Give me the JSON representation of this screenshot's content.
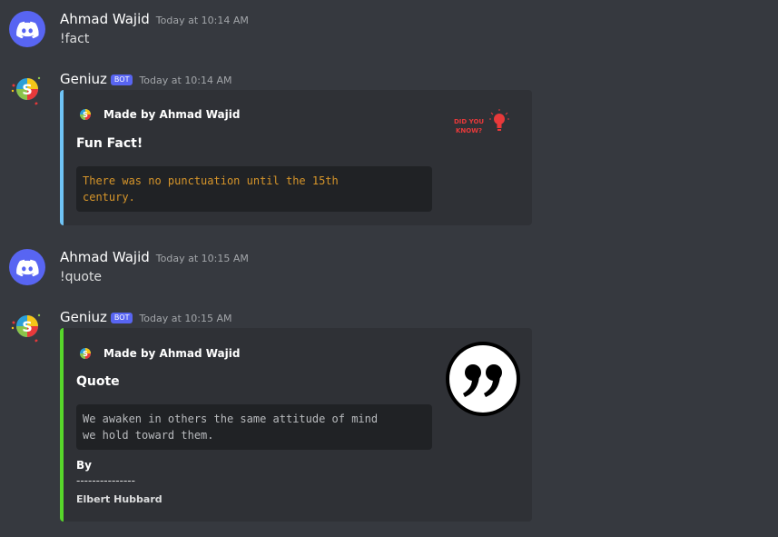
{
  "messages": [
    {
      "username": "Ahmad Wajid",
      "timestamp": "Today at 10:14 AM",
      "content": "!fact"
    },
    {
      "username": "Geniuz",
      "bot_badge": "BOT",
      "timestamp": "Today at 10:14 AM",
      "embed": {
        "author": "Made by Ahmad Wajid",
        "title": "Fun Fact!",
        "code": "There was no punctuation until the 15th\ncentury.",
        "thumbnail_text_line1": "DID YOU",
        "thumbnail_text_line2": "KNOW?",
        "accent_color": "#6fc3f5"
      }
    },
    {
      "username": "Ahmad Wajid",
      "timestamp": "Today at 10:15 AM",
      "content": "!quote"
    },
    {
      "username": "Geniuz",
      "bot_badge": "BOT",
      "timestamp": "Today at 10:15 AM",
      "embed": {
        "author": "Made by Ahmad Wajid",
        "title": "Quote",
        "code": "We awaken in others the same attitude of mind\nwe hold toward them.",
        "field_name": "By",
        "field_divider": "---------------",
        "field_value": "Elbert Hubbard",
        "accent_color": "#57d62a"
      }
    }
  ],
  "colors": {
    "background": "#36393f",
    "embed_background": "#2f3136",
    "codeblock_background": "#202225",
    "blurple": "#5865f2"
  },
  "icons": {
    "user_avatar": "discord-logo-icon",
    "bot_avatar": "geniuz-logo-icon",
    "fact_thumbnail": "did-you-know-lightbulb-icon",
    "quote_thumbnail": "quote-marks-icon"
  }
}
